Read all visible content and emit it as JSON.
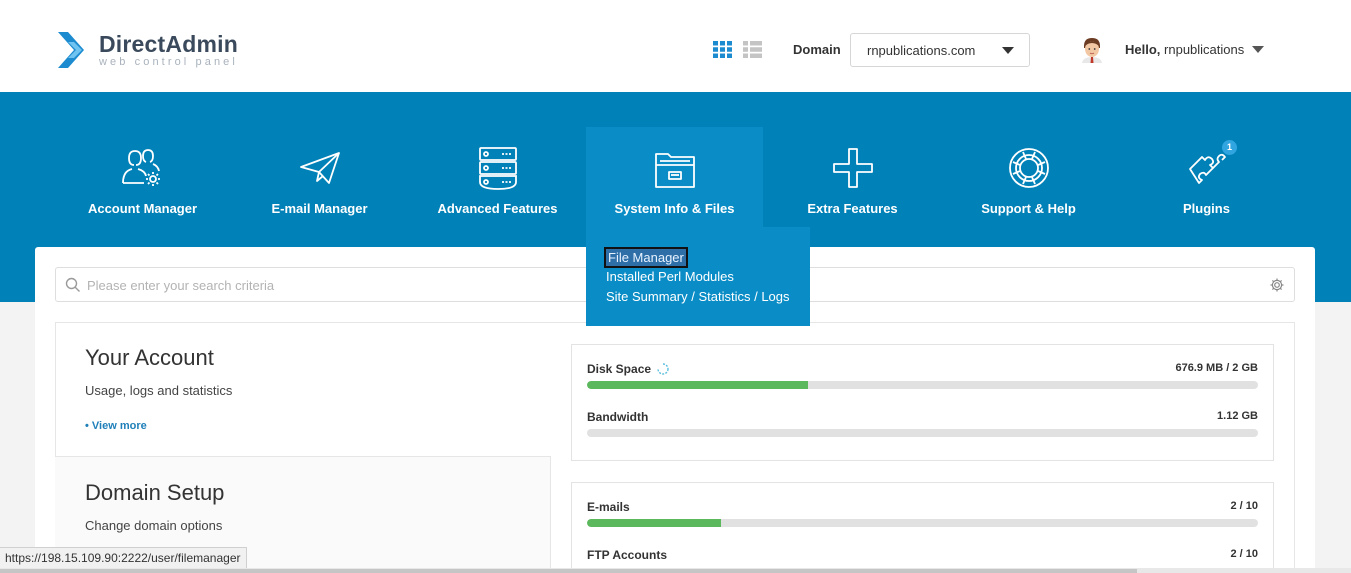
{
  "header": {
    "logo_main": "DirectAdmin",
    "logo_sub": "web control panel",
    "domain_label": "Domain",
    "domain_value": "rnpublications.com",
    "hello_prefix": "Hello,",
    "username": "rnpublications"
  },
  "nav": {
    "items": [
      {
        "label": "Account Manager",
        "icon": "users-gear-icon"
      },
      {
        "label": "E-mail Manager",
        "icon": "paper-plane-icon"
      },
      {
        "label": "Advanced Features",
        "icon": "server-icon"
      },
      {
        "label": "System Info & Files",
        "icon": "folder-icon"
      },
      {
        "label": "Extra Features",
        "icon": "plus-icon"
      },
      {
        "label": "Support & Help",
        "icon": "lifebuoy-icon"
      },
      {
        "label": "Plugins",
        "icon": "puzzle-icon",
        "badge": "1"
      }
    ],
    "active_index": 3
  },
  "dropdown": {
    "items": [
      "File Manager",
      "Installed Perl Modules",
      "Site Summary / Statistics / Logs"
    ],
    "selected_index": 0
  },
  "search": {
    "placeholder": "Please enter your search criteria"
  },
  "account": {
    "title": "Your Account",
    "subtitle": "Usage, logs and statistics",
    "link": "• View more"
  },
  "domain_setup": {
    "title": "Domain Setup",
    "subtitle": "Change domain options"
  },
  "stats": [
    {
      "name": "Disk Space",
      "value": "676.9 MB / 2 GB",
      "fill": 0.33
    },
    {
      "name": "Bandwidth",
      "value": "1.12 GB",
      "fill": 0
    },
    {
      "name": "E-mails",
      "value": "2 / 10",
      "fill": 0.2
    },
    {
      "name": "FTP Accounts",
      "value": "2 / 10",
      "fill": 0.2
    }
  ],
  "statusbar": {
    "url": "https://198.15.109.90:2222/user/filemanager"
  },
  "colors": {
    "nav_bg": "#0081b7",
    "nav_active": "#0a8dc6",
    "bar_fill": "#5cb85c",
    "logo_blue": "#1c8bd0"
  }
}
